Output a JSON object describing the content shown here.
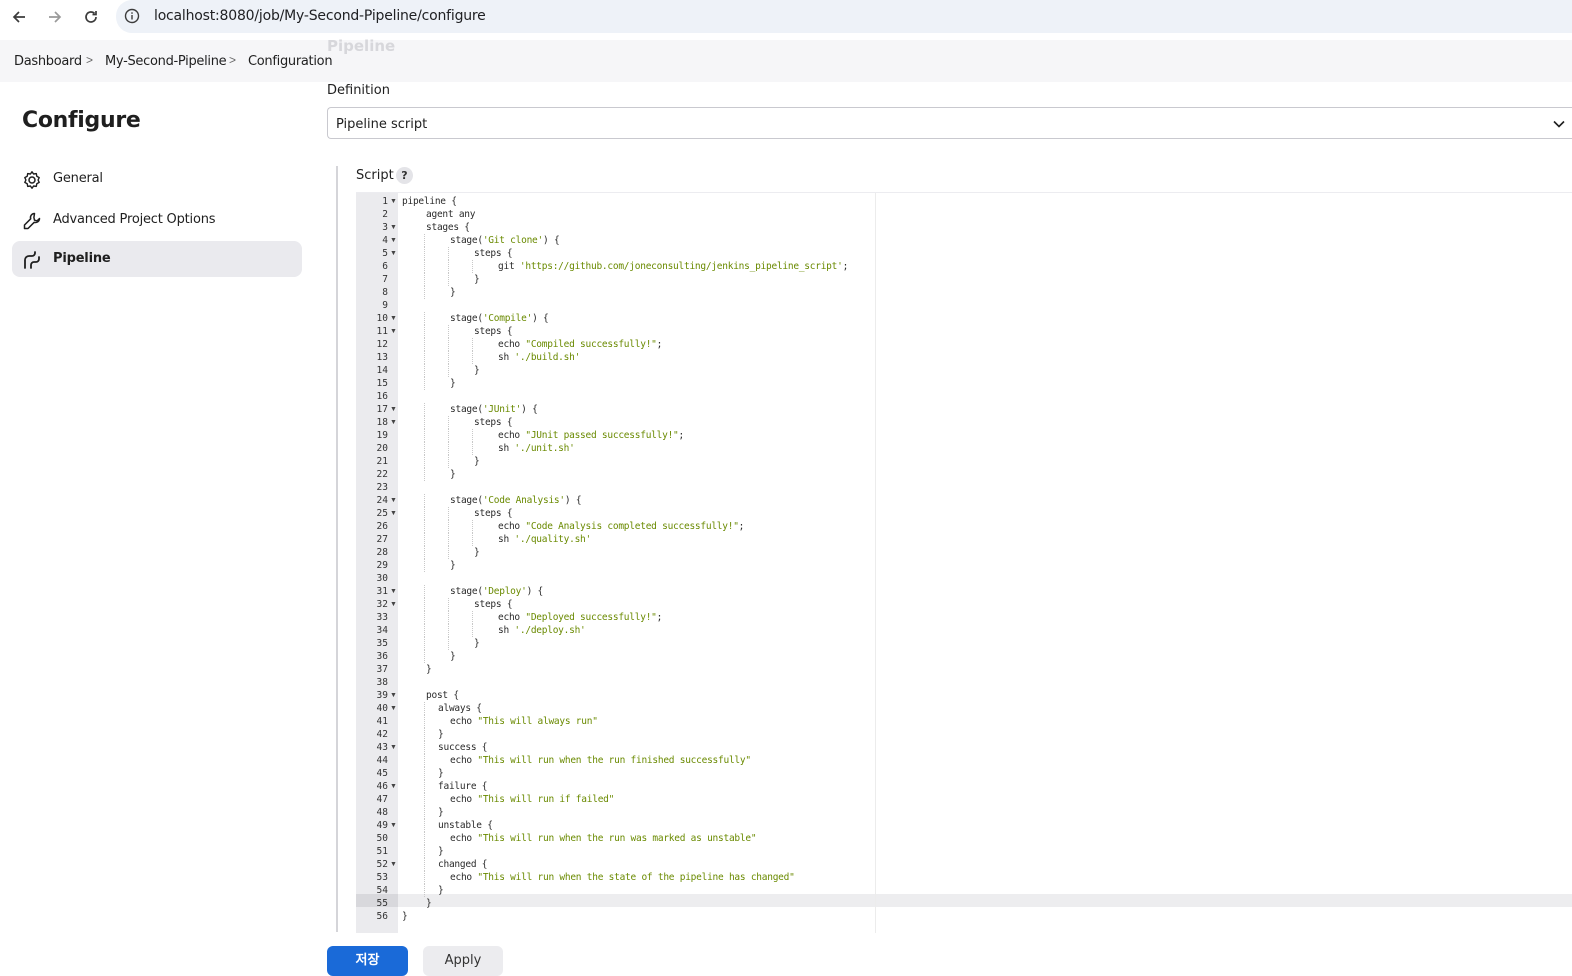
{
  "browser": {
    "url": "localhost:8080/job/My-Second-Pipeline/configure"
  },
  "breadcrumb": {
    "items": [
      "Dashboard",
      "My-Second-Pipeline",
      "Configuration"
    ],
    "separator": ">"
  },
  "ghost_heading": "Pipeline",
  "sidebar": {
    "title": "Configure",
    "items": [
      {
        "label": "General",
        "icon": "gear-icon",
        "active": false
      },
      {
        "label": "Advanced Project Options",
        "icon": "wrench-icon",
        "active": false
      },
      {
        "label": "Pipeline",
        "icon": "pipeline-icon",
        "active": true
      }
    ]
  },
  "definition": {
    "label": "Definition",
    "selected": "Pipeline script"
  },
  "script": {
    "label": "Script",
    "help": "?",
    "active_line": 55,
    "lines": [
      {
        "n": 1,
        "fold": true,
        "indent": 0,
        "code": "pipeline {"
      },
      {
        "n": 2,
        "fold": false,
        "indent": 1,
        "code": "agent any"
      },
      {
        "n": 3,
        "fold": true,
        "indent": 1,
        "code": "stages {"
      },
      {
        "n": 4,
        "fold": true,
        "indent": 2,
        "code": "stage('Git clone') {"
      },
      {
        "n": 5,
        "fold": true,
        "indent": 3,
        "code": "steps {"
      },
      {
        "n": 6,
        "fold": false,
        "indent": 4,
        "code": "git 'https://github.com/joneconsulting/jenkins_pipeline_script';"
      },
      {
        "n": 7,
        "fold": false,
        "indent": 3,
        "code": "}"
      },
      {
        "n": 8,
        "fold": false,
        "indent": 2,
        "code": "}"
      },
      {
        "n": 9,
        "fold": false,
        "indent": 0,
        "code": ""
      },
      {
        "n": 10,
        "fold": true,
        "indent": 2,
        "code": "stage('Compile') {"
      },
      {
        "n": 11,
        "fold": true,
        "indent": 3,
        "code": "steps {"
      },
      {
        "n": 12,
        "fold": false,
        "indent": 4,
        "code": "echo \"Compiled successfully!\";"
      },
      {
        "n": 13,
        "fold": false,
        "indent": 4,
        "code": "sh './build.sh'"
      },
      {
        "n": 14,
        "fold": false,
        "indent": 3,
        "code": "}"
      },
      {
        "n": 15,
        "fold": false,
        "indent": 2,
        "code": "}"
      },
      {
        "n": 16,
        "fold": false,
        "indent": 0,
        "code": ""
      },
      {
        "n": 17,
        "fold": true,
        "indent": 2,
        "code": "stage('JUnit') {"
      },
      {
        "n": 18,
        "fold": true,
        "indent": 3,
        "code": "steps {"
      },
      {
        "n": 19,
        "fold": false,
        "indent": 4,
        "code": "echo \"JUnit passed successfully!\";"
      },
      {
        "n": 20,
        "fold": false,
        "indent": 4,
        "code": "sh './unit.sh'"
      },
      {
        "n": 21,
        "fold": false,
        "indent": 3,
        "code": "}"
      },
      {
        "n": 22,
        "fold": false,
        "indent": 2,
        "code": "}"
      },
      {
        "n": 23,
        "fold": false,
        "indent": 0,
        "code": ""
      },
      {
        "n": 24,
        "fold": true,
        "indent": 2,
        "code": "stage('Code Analysis') {"
      },
      {
        "n": 25,
        "fold": true,
        "indent": 3,
        "code": "steps {"
      },
      {
        "n": 26,
        "fold": false,
        "indent": 4,
        "code": "echo \"Code Analysis completed successfully!\";"
      },
      {
        "n": 27,
        "fold": false,
        "indent": 4,
        "code": "sh './quality.sh'"
      },
      {
        "n": 28,
        "fold": false,
        "indent": 3,
        "code": "}"
      },
      {
        "n": 29,
        "fold": false,
        "indent": 2,
        "code": "}"
      },
      {
        "n": 30,
        "fold": false,
        "indent": 0,
        "code": ""
      },
      {
        "n": 31,
        "fold": true,
        "indent": 2,
        "code": "stage('Deploy') {"
      },
      {
        "n": 32,
        "fold": true,
        "indent": 3,
        "code": "steps {"
      },
      {
        "n": 33,
        "fold": false,
        "indent": 4,
        "code": "echo \"Deployed successfully!\";"
      },
      {
        "n": 34,
        "fold": false,
        "indent": 4,
        "code": "sh './deploy.sh'"
      },
      {
        "n": 35,
        "fold": false,
        "indent": 3,
        "code": "}"
      },
      {
        "n": 36,
        "fold": false,
        "indent": 2,
        "code": "}"
      },
      {
        "n": 37,
        "fold": false,
        "indent": 1,
        "code": "}"
      },
      {
        "n": 38,
        "fold": false,
        "indent": 0,
        "code": ""
      },
      {
        "n": 39,
        "fold": true,
        "indent": 1,
        "code": "post {"
      },
      {
        "n": 40,
        "fold": true,
        "indent": 1.5,
        "code": "always {"
      },
      {
        "n": 41,
        "fold": false,
        "indent": 2,
        "code": "echo \"This will always run\""
      },
      {
        "n": 42,
        "fold": false,
        "indent": 1.5,
        "code": "}"
      },
      {
        "n": 43,
        "fold": true,
        "indent": 1.5,
        "code": "success {"
      },
      {
        "n": 44,
        "fold": false,
        "indent": 2,
        "code": "echo \"This will run when the run finished successfully\""
      },
      {
        "n": 45,
        "fold": false,
        "indent": 1.5,
        "code": "}"
      },
      {
        "n": 46,
        "fold": true,
        "indent": 1.5,
        "code": "failure {"
      },
      {
        "n": 47,
        "fold": false,
        "indent": 2,
        "code": "echo \"This will run if failed\""
      },
      {
        "n": 48,
        "fold": false,
        "indent": 1.5,
        "code": "}"
      },
      {
        "n": 49,
        "fold": true,
        "indent": 1.5,
        "code": "unstable {"
      },
      {
        "n": 50,
        "fold": false,
        "indent": 2,
        "code": "echo \"This will run when the run was marked as unstable\""
      },
      {
        "n": 51,
        "fold": false,
        "indent": 1.5,
        "code": "}"
      },
      {
        "n": 52,
        "fold": true,
        "indent": 1.5,
        "code": "changed {"
      },
      {
        "n": 53,
        "fold": false,
        "indent": 2,
        "code": "echo \"This will run when the state of the pipeline has changed\""
      },
      {
        "n": 54,
        "fold": false,
        "indent": 1.5,
        "code": "}"
      },
      {
        "n": 55,
        "fold": false,
        "indent": 1,
        "code": "}"
      },
      {
        "n": 56,
        "fold": false,
        "indent": 0,
        "code": "}"
      }
    ]
  },
  "buttons": {
    "save": "저장",
    "apply": "Apply"
  },
  "colors": {
    "primary": "#1a6ad8",
    "string": "#6a8a00",
    "active_nav": "#eaeaee"
  }
}
